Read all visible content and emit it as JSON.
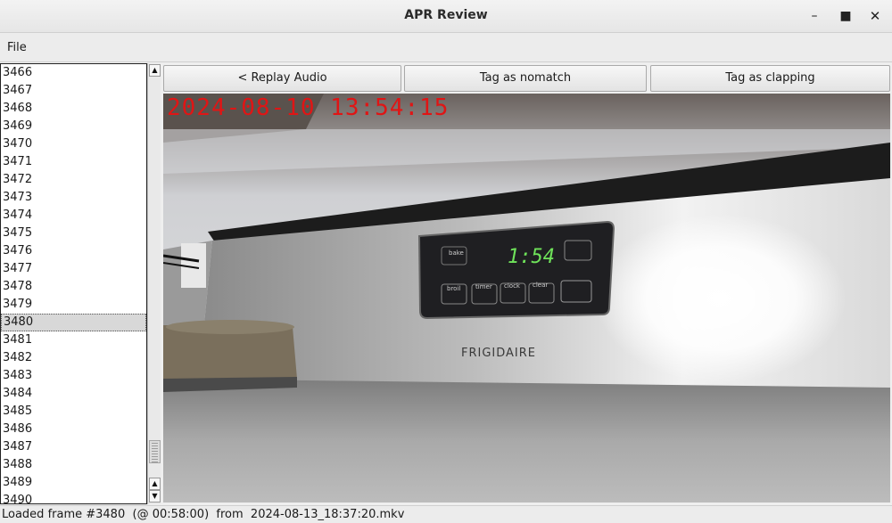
{
  "window": {
    "title": "APR Review",
    "controls": {
      "minimize": "–",
      "maximize": "■",
      "close": "✕"
    }
  },
  "menu": {
    "file": "File"
  },
  "frame_list": {
    "items": [
      "3466",
      "3467",
      "3468",
      "3469",
      "3470",
      "3471",
      "3472",
      "3473",
      "3474",
      "3475",
      "3476",
      "3477",
      "3478",
      "3479",
      "3480",
      "3481",
      "3482",
      "3483",
      "3484",
      "3485",
      "3486",
      "3487",
      "3488",
      "3489",
      "3490"
    ],
    "selected": "3480"
  },
  "scrollbar": {
    "up": "▲",
    "down": "▼"
  },
  "toolbar": {
    "replay_label": "< Replay Audio",
    "nomatch_label": "Tag as nomatch",
    "clapping_label": "Tag as clapping"
  },
  "video": {
    "timestamp_overlay": "2024-08-10 13:54:15",
    "oven_display": "1:54",
    "brand": "FRIGIDAIRE",
    "key_labels": [
      "bake",
      "broil",
      "timer",
      "clock",
      "clear"
    ]
  },
  "status": {
    "text": "Loaded frame #3480  (@ 00:58:00)  from  2024-08-13_18:37:20.mkv"
  }
}
